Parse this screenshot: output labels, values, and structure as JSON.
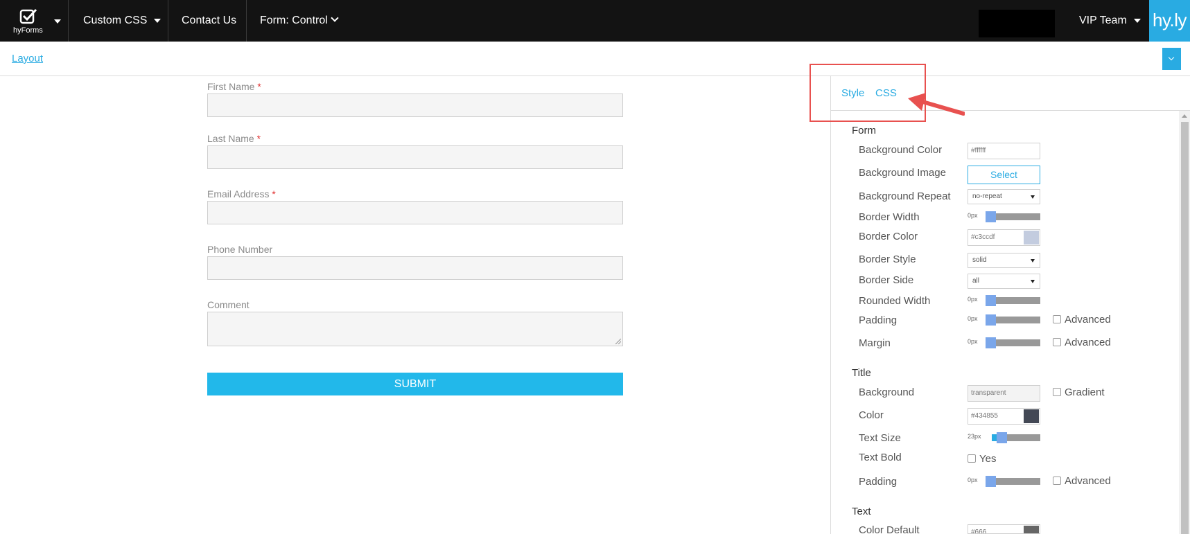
{
  "nav": {
    "logo_text": "hyForms",
    "custom_css": "Custom CSS",
    "contact_us": "Contact Us",
    "form_control": "Form: Control",
    "vip_team": "VIP Team",
    "brand": "hy.ly"
  },
  "subheader": {
    "layout_link": "Layout"
  },
  "form": {
    "fields": [
      {
        "label": "First Name",
        "required": "*"
      },
      {
        "label": "Last Name",
        "required": "*"
      },
      {
        "label": "Email Address",
        "required": "*"
      },
      {
        "label": "Phone Number",
        "required": ""
      },
      {
        "label": "Comment",
        "required": ""
      }
    ],
    "submit_label": "SUBMIT"
  },
  "panel": {
    "tabs": {
      "style": "Style",
      "css": "CSS"
    },
    "form_section": {
      "title": "Form",
      "background_color": {
        "label": "Background Color",
        "value": "#ffffff",
        "swatch": "#ffffff"
      },
      "background_image": {
        "label": "Background Image",
        "button": "Select"
      },
      "background_repeat": {
        "label": "Background Repeat",
        "value": "no-repeat"
      },
      "border_width": {
        "label": "Border Width",
        "value": "0px"
      },
      "border_color": {
        "label": "Border Color",
        "value": "#c3ccdf",
        "swatch": "#c3ccdf"
      },
      "border_style": {
        "label": "Border Style",
        "value": "solid"
      },
      "border_side": {
        "label": "Border Side",
        "value": "all"
      },
      "rounded_width": {
        "label": "Rounded Width",
        "value": "0px"
      },
      "padding": {
        "label": "Padding",
        "value": "0px",
        "advanced": "Advanced"
      },
      "margin": {
        "label": "Margin",
        "value": "0px",
        "advanced": "Advanced"
      }
    },
    "title_section": {
      "title": "Title",
      "background": {
        "label": "Background",
        "value": "transparent",
        "gradient": "Gradient"
      },
      "color": {
        "label": "Color",
        "value": "#434855",
        "swatch": "#434855"
      },
      "text_size": {
        "label": "Text Size",
        "value": "23px",
        "level": 0.2
      },
      "text_bold": {
        "label": "Text Bold",
        "option": "Yes"
      },
      "padding": {
        "label": "Padding",
        "value": "0px",
        "advanced": "Advanced"
      }
    },
    "text_section": {
      "title": "Text",
      "color_default": {
        "label": "Color Default",
        "value": "#666",
        "swatch": "#666666"
      }
    }
  },
  "colors": {
    "accent": "#29abe2",
    "nav_bg": "#131313",
    "annotation": "#e8514f"
  }
}
